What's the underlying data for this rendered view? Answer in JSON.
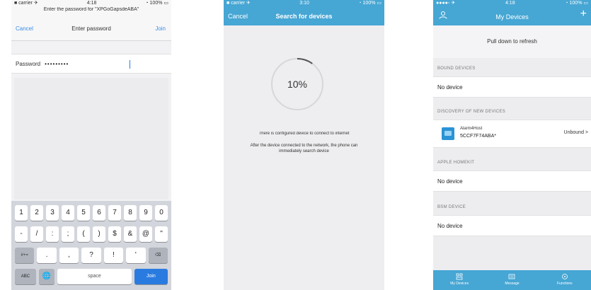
{
  "screen1": {
    "status": {
      "carrier": "■ carrier ✈",
      "time": "4:18",
      "battery": "◔ 100% ▭"
    },
    "prompt": "Enter the password for \"XPGoGapsdeABA\"",
    "nav": {
      "cancel": "Cancel",
      "title": "Enter password",
      "join": "Join"
    },
    "password_label": "Password",
    "password_value": "•••••••••",
    "keyboard": {
      "row1": [
        "1",
        "2",
        "3",
        "4",
        "5",
        "6",
        "7",
        "8",
        "9",
        "0"
      ],
      "row2": [
        "-",
        "/",
        ":",
        ";",
        "(",
        ")",
        "$",
        "&",
        "@",
        "\""
      ],
      "row3": [
        "#+=",
        ".",
        ",",
        "?",
        "!",
        "'",
        "⌫"
      ],
      "row4": {
        "abc": "ABC",
        "globe": "🌐",
        "space": "space",
        "join": "Join"
      }
    }
  },
  "screen2": {
    "status": {
      "carrier": "■ carrier ✈",
      "time": "3:10",
      "battery": "◔ 100% ▭"
    },
    "nav": {
      "cancel": "Cancel",
      "title": "Search for devices"
    },
    "progress": {
      "label": "10%",
      "value": 10
    },
    "message1": "There is configured device to connect to internet",
    "message2": "After the device connected to the network, the phone can immediately search device"
  },
  "screen3": {
    "status": {
      "carrier": "●●●●◦ ✈",
      "time": "4:18",
      "battery": "◔ 100% ▭"
    },
    "nav": {
      "title": "My Devices",
      "add": "+"
    },
    "pull_to_refresh": "Pull down to refresh",
    "sections": {
      "bound": {
        "header": "BOUND DEVICES",
        "empty": "No device"
      },
      "discovery": {
        "header": "DISCOVERY OF NEW DEVICES",
        "device_name": "Alarm4Host",
        "device_mac": "5CCF7F74ABA*",
        "device_status": "Unbound >"
      },
      "apple": {
        "header": "APPLE HOMEKIT",
        "empty": "No device"
      },
      "bsm": {
        "header": "BSM DEVICE",
        "empty": "No device"
      }
    },
    "tabs": [
      "My Devices",
      "Message",
      "Functions"
    ],
    "colors": {
      "accent": "#46a6d4",
      "device_icon": "#2a93d5",
      "join_key": "#2a7be0"
    }
  }
}
